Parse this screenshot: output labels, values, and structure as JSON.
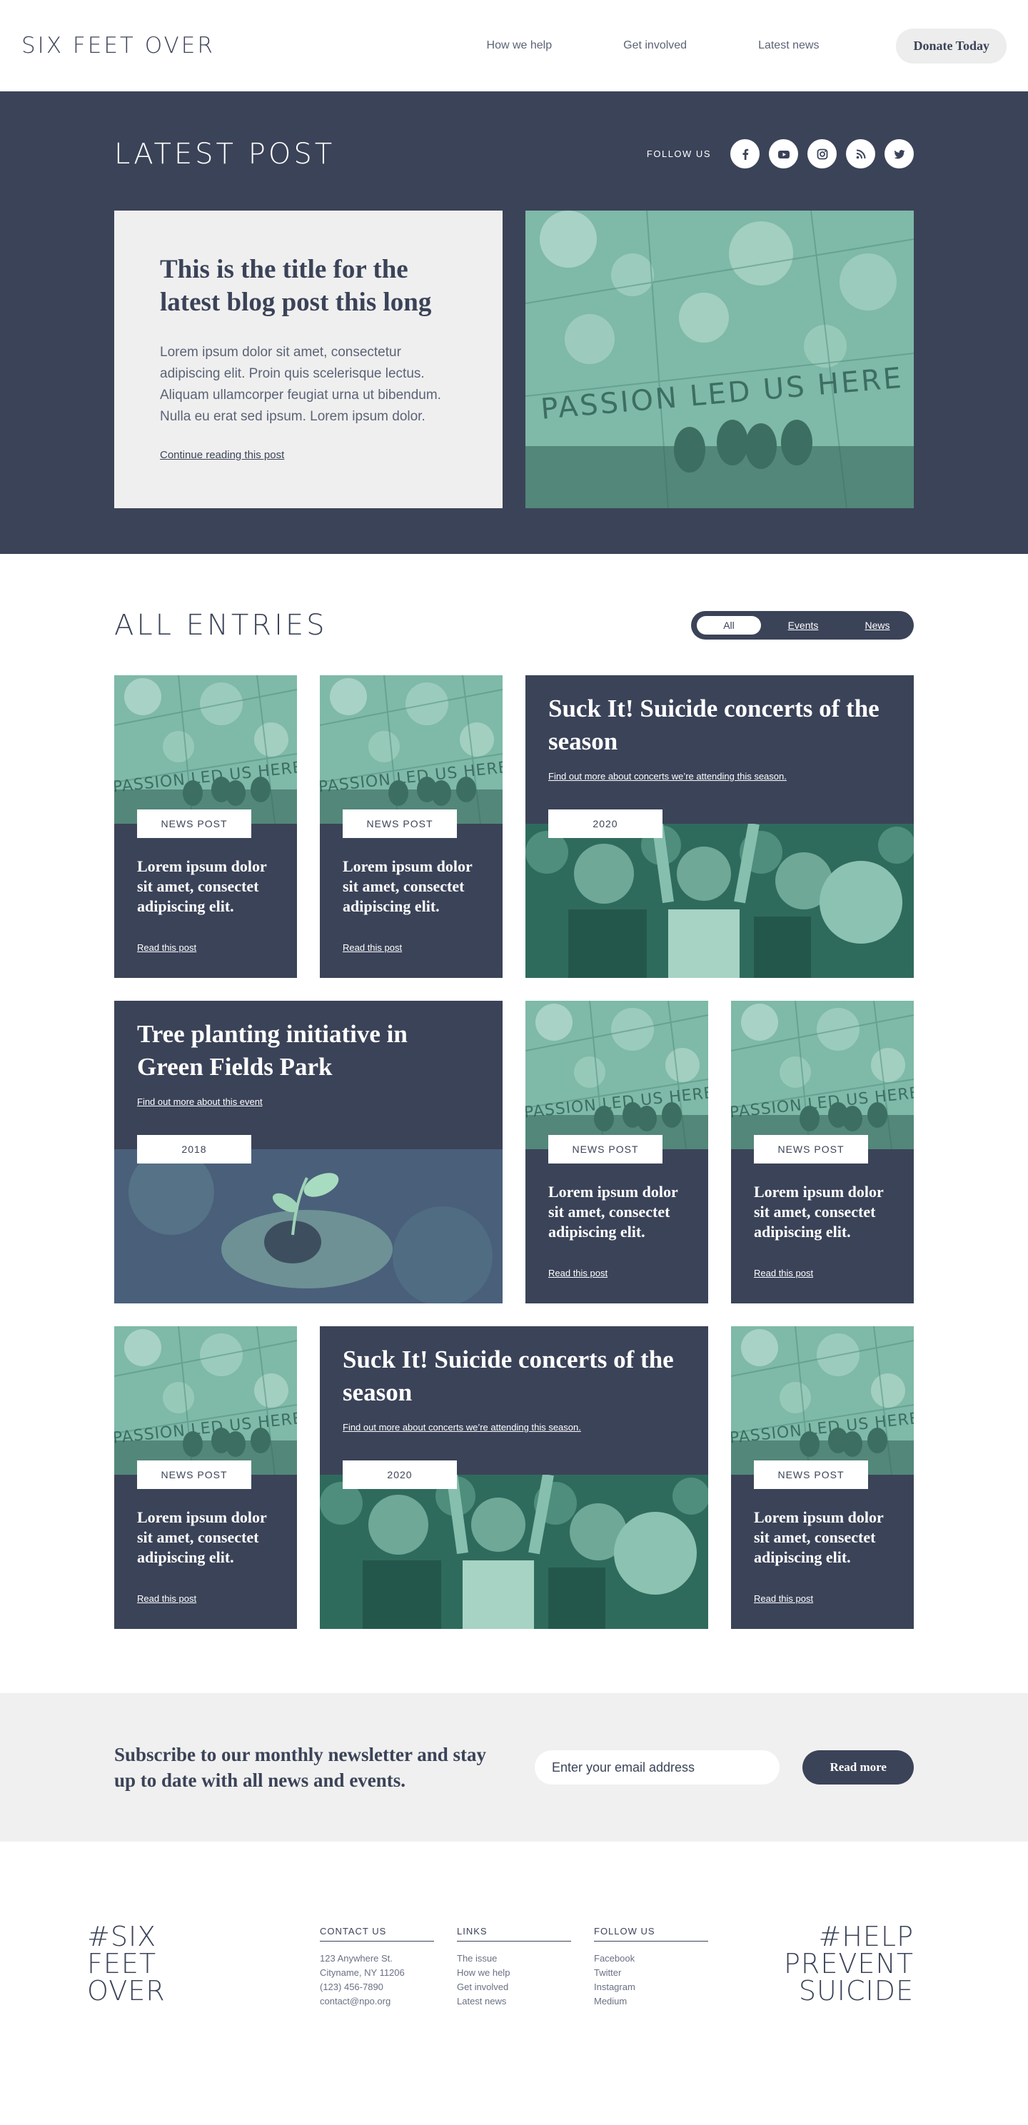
{
  "header": {
    "logo": "SIX FEET OVER",
    "nav": [
      "How we help",
      "Get involved",
      "Latest news"
    ],
    "donate_label": "Donate Today"
  },
  "latest": {
    "section_title": "LATEST POST",
    "follow_label": "FOLLOW US",
    "social_icons": [
      "facebook-icon",
      "youtube-icon",
      "instagram-icon",
      "rss-icon",
      "twitter-icon"
    ],
    "post_title": "This is the title for the latest blog post this long",
    "post_excerpt": "Lorem ipsum dolor sit amet, consectetur adipiscing elit. Proin quis scelerisque lectus. Aliquam ullamcorper feugiat urna ut bibendum. Nulla eu erat sed ipsum. Lorem ipsum dolor.",
    "post_link": "Continue reading this post",
    "image_text": "PASSION LED US HERE"
  },
  "entries": {
    "section_title": "ALL ENTRIES",
    "filters": [
      "All",
      "Events",
      "News"
    ],
    "active_filter": "All",
    "news_card": {
      "tag": "NEWS POST",
      "title": "Lorem ipsum dolor sit amet, consectet adipiscing elit.",
      "link": "Read this post"
    },
    "concert": {
      "title": "Suck It! Suicide concerts of the season",
      "link": "Find out more about concerts we’re attending this season.",
      "tag": "2020"
    },
    "tree": {
      "title": "Tree planting initiative in Green Fields Park",
      "link": "Find out more about this event",
      "tag": "2018"
    }
  },
  "newsletter": {
    "heading": "Subscribe to our monthly newsletter and stay up to date with all news and events.",
    "placeholder": "Enter your email address",
    "button": "Read more"
  },
  "footer": {
    "left_hashtag": [
      "#SIX",
      "FEET",
      "OVER"
    ],
    "right_hashtag": [
      "#HELP",
      "PREVENT",
      "SUICIDE"
    ],
    "contact": {
      "title": "CONTACT US",
      "items": [
        "123 Anywhere St.",
        "Cityname, NY 11206",
        "(123) 456-7890",
        "contact@npo.org"
      ]
    },
    "links": {
      "title": "LINKS",
      "items": [
        "The issue",
        "How we help",
        "Get involved",
        "Latest news"
      ]
    },
    "follow": {
      "title": "FOLLOW US",
      "items": [
        "Facebook",
        "Twitter",
        "Instagram",
        "Medium"
      ]
    }
  },
  "colors": {
    "navy": "#3b4358",
    "mint": "#86bfae",
    "light": "#f0f0f0"
  }
}
